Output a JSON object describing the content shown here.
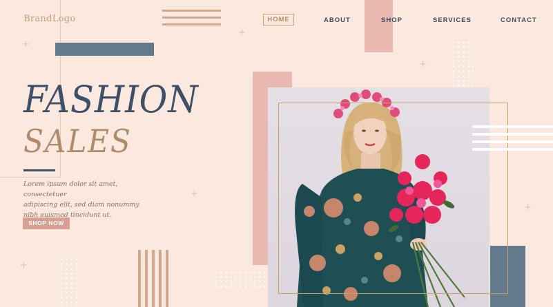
{
  "brand": {
    "logo_text": "BrandLogo"
  },
  "nav": {
    "items": [
      {
        "label": "HOME"
      },
      {
        "label": "ABOUT"
      },
      {
        "label": "SHOP"
      },
      {
        "label": "SERVICES"
      },
      {
        "label": "CONTACT"
      }
    ]
  },
  "hero": {
    "title_line1": "FASHION",
    "title_line2": "SALES",
    "description_line1": "Lorem ipsum dolor sit amet, consectetuer",
    "description_line2": "adipiscing elit, sed diam nonummy",
    "description_line3": "nibh euismod tincidunt ut.",
    "cta_label": "SHOP NOW"
  },
  "colors": {
    "background": "#fbe9df",
    "slate": "#637a8d",
    "title_blue": "#3d5068",
    "title_tan": "#b08a6b",
    "pink": "#e8b8b1",
    "button": "#d99f93",
    "gold": "#c8a15e"
  },
  "photo": {
    "subject": "woman in floral dress holding red carnations"
  }
}
